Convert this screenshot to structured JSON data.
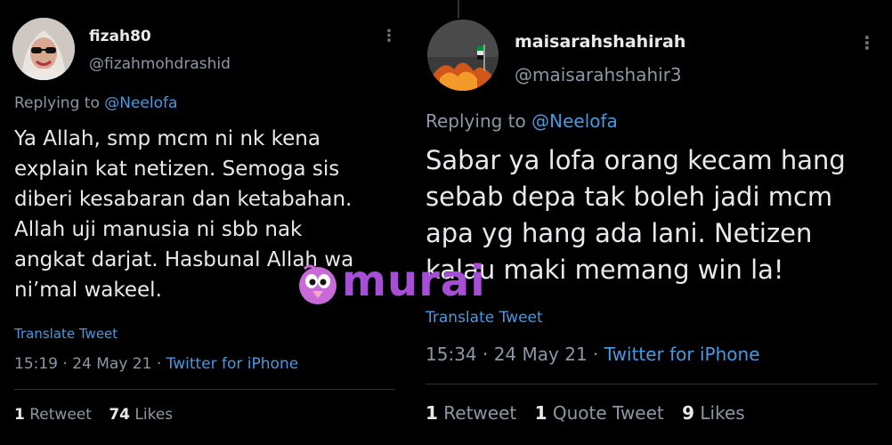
{
  "left_tweet": {
    "display_name": "fizah80",
    "handle": "@fizahmohdrashid",
    "more_icon": "⋮",
    "replying_prefix": "Replying to",
    "replying_to": "@Neelofa",
    "body": "Ya Allah, smp mcm ni nk kena\nexplain kat netizen. Semoga sis\ndiberi kesabaran dan ketabahan.\nAllah uji manusia ni sbb nak\nangkat darjat. Hasbunal Allah wa\nni’mal wakeel.",
    "translate_label": "Translate Tweet",
    "time": "15:19 · 24 May 21 ·",
    "source": "Twitter for iPhone",
    "retweet_count": "1",
    "retweet_label": "Retweet",
    "like_count": "74",
    "like_label": "Likes"
  },
  "right_tweet": {
    "display_name": "maisarahshahirah",
    "handle": "@maisarahshahir3",
    "more_icon": "⋮",
    "replying_prefix": "Replying to",
    "replying_to": "@Neelofa",
    "body": "Sabar ya lofa orang kecam hang\nsebab depa tak boleh jadi mcm\napa yg hang ada lani. Netizen\nkalau maki memang win la!",
    "translate_label": "Translate Tweet",
    "time": "15:34 · 24 May 21 ·",
    "source": "Twitter for iPhone",
    "retweet_count": "1",
    "retweet_label": "Retweet",
    "quote_count": "1",
    "quote_label": "Quote Tweet",
    "like_count": "9",
    "like_label": "Likes"
  },
  "watermark": {
    "text": "murai",
    "color": "#a64fd6"
  },
  "colors": {
    "background": "#000000",
    "text": "#e7e9ea",
    "muted": "#8b98a5",
    "link": "#4a98e0"
  }
}
